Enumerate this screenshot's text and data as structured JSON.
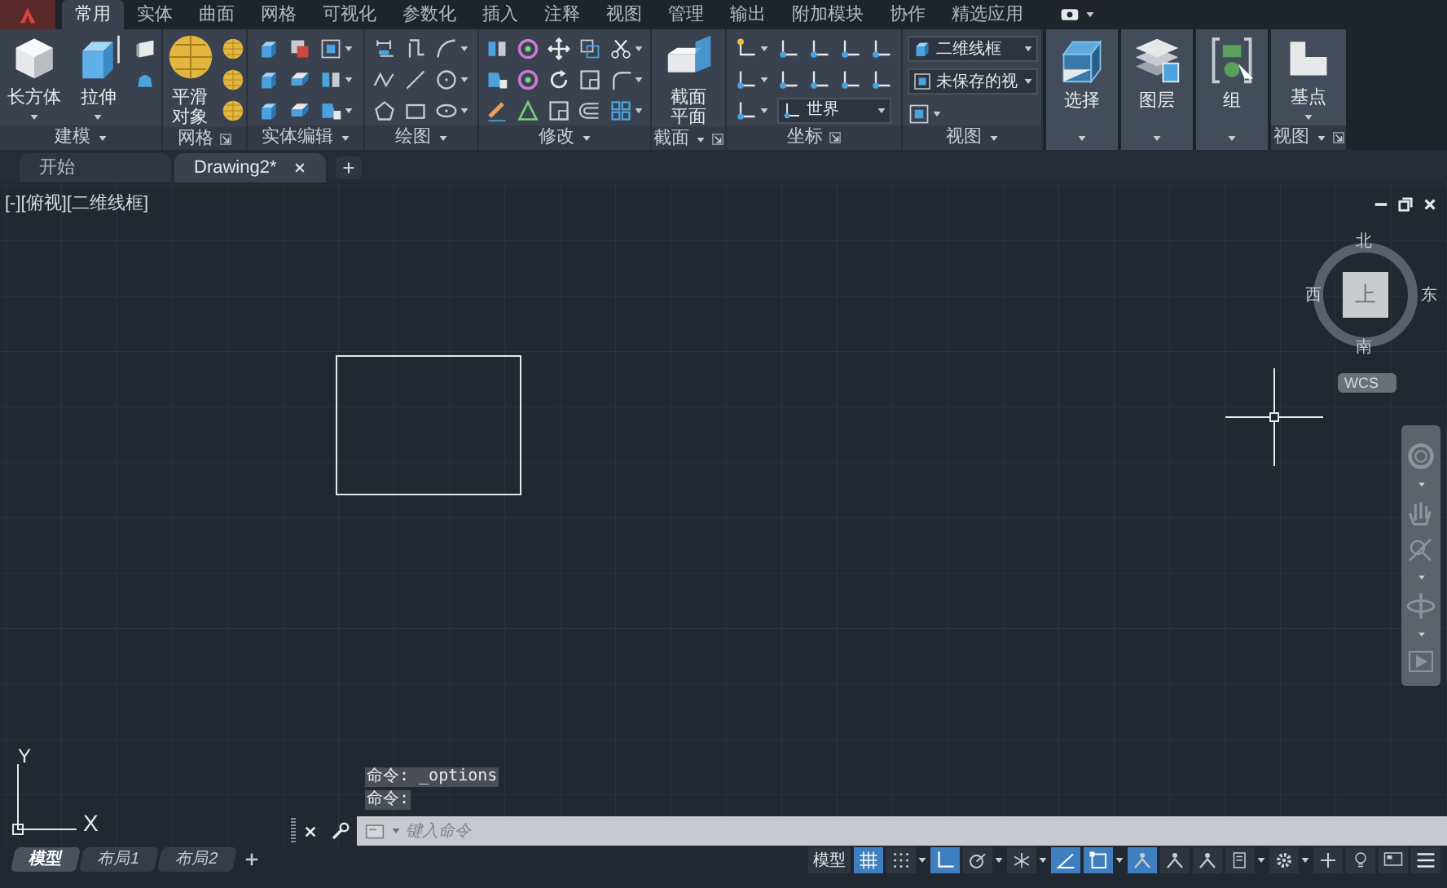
{
  "ribbon_tabs": [
    {
      "label": "常用",
      "selected": true
    },
    {
      "label": "实体",
      "selected": false
    },
    {
      "label": "曲面",
      "selected": false
    },
    {
      "label": "网格",
      "selected": false
    },
    {
      "label": "可视化",
      "selected": false
    },
    {
      "label": "参数化",
      "selected": false
    },
    {
      "label": "插入",
      "selected": false
    },
    {
      "label": "注释",
      "selected": false
    },
    {
      "label": "视图",
      "selected": false
    },
    {
      "label": "管理",
      "selected": false
    },
    {
      "label": "输出",
      "selected": false
    },
    {
      "label": "附加模块",
      "selected": false
    },
    {
      "label": "协作",
      "selected": false
    },
    {
      "label": "精选应用",
      "selected": false
    }
  ],
  "ribbon_panels": [
    {
      "title": "建模",
      "menu": true,
      "launcher": false,
      "buttons": [
        {
          "label": "长方体",
          "dropdown": true
        },
        {
          "label": "拉伸",
          "dropdown": true
        }
      ]
    },
    {
      "title": "网格",
      "menu": false,
      "launcher": true,
      "buttons": [
        {
          "label": "平滑对象",
          "dropdown": false
        }
      ]
    },
    {
      "title": "实体编辑",
      "menu": true,
      "launcher": false
    },
    {
      "title": "绘图",
      "menu": true,
      "launcher": false
    },
    {
      "title": "修改",
      "menu": true,
      "launcher": false
    },
    {
      "title": "截面",
      "menu": true,
      "launcher": true,
      "buttons": [
        {
          "label": "截面平面",
          "dropdown": false
        }
      ]
    },
    {
      "title": "坐标",
      "menu": false,
      "launcher": true,
      "dropdowns": [
        {
          "value": "世界"
        }
      ]
    },
    {
      "title": "视图",
      "menu": true,
      "launcher": false,
      "dropdowns": [
        {
          "value": "二维线框"
        },
        {
          "value": "未保存的视"
        }
      ]
    },
    {
      "menu": true,
      "launcher": false,
      "buttons": [
        {
          "label": "选择",
          "dropdown": false
        }
      ]
    },
    {
      "menu": true,
      "launcher": false,
      "buttons": [
        {
          "label": "图层",
          "dropdown": false
        }
      ]
    },
    {
      "menu": true,
      "launcher": false,
      "buttons": [
        {
          "label": "组",
          "dropdown": false
        }
      ]
    },
    {
      "title": "视图",
      "menu": true,
      "launcher": true,
      "buttons": [
        {
          "label": "基点",
          "dropdown": true
        }
      ]
    }
  ],
  "document_tabs": [
    {
      "label": "开始",
      "selected": false,
      "closable": false
    },
    {
      "label": "Drawing2*",
      "selected": true,
      "closable": true
    }
  ],
  "viewport": {
    "controls": [
      "[-]",
      "[俯视]",
      "[二维线框]"
    ],
    "viewcube": {
      "north": "北",
      "west": "西",
      "east": "东",
      "south": "南",
      "face": "上",
      "coordinate_system": "WCS"
    },
    "ucs": {
      "y_label": "Y",
      "x_label": "X"
    }
  },
  "command_history": [
    "命令: _options",
    "命令:"
  ],
  "command_line": {
    "placeholder": "键入命令"
  },
  "layout_tabs": [
    {
      "label": "模型",
      "selected": true
    },
    {
      "label": "布局1",
      "selected": false
    },
    {
      "label": "布局2",
      "selected": false
    }
  ],
  "status_bar": [
    {
      "kind": "label",
      "label": "模型"
    },
    {
      "kind": "grid",
      "on": true,
      "dropdown": false
    },
    {
      "kind": "snap",
      "on": false,
      "dropdown": true
    },
    {
      "kind": "ortho",
      "on": true,
      "dropdown": false
    },
    {
      "kind": "polar",
      "on": false,
      "dropdown": true
    },
    {
      "kind": "isodraft",
      "on": false,
      "dropdown": true
    },
    {
      "kind": "angle",
      "on": true,
      "dropdown": false
    },
    {
      "kind": "corner",
      "on": true,
      "dropdown": true
    },
    {
      "kind": "annotation",
      "on": true,
      "dropdown": false
    },
    {
      "kind": "annotation",
      "on": false,
      "dropdown": false
    },
    {
      "kind": "annotation",
      "on": false,
      "dropdown": false
    },
    {
      "kind": "scale",
      "on": false,
      "dropdown": true
    },
    {
      "kind": "gear",
      "on": false,
      "dropdown": true
    },
    {
      "kind": "plus",
      "on": false,
      "dropdown": false
    },
    {
      "kind": "isolate",
      "on": false,
      "dropdown": false
    },
    {
      "kind": "monitor",
      "on": false,
      "dropdown": false
    },
    {
      "kind": "menu",
      "on": false,
      "dropdown": false
    }
  ]
}
